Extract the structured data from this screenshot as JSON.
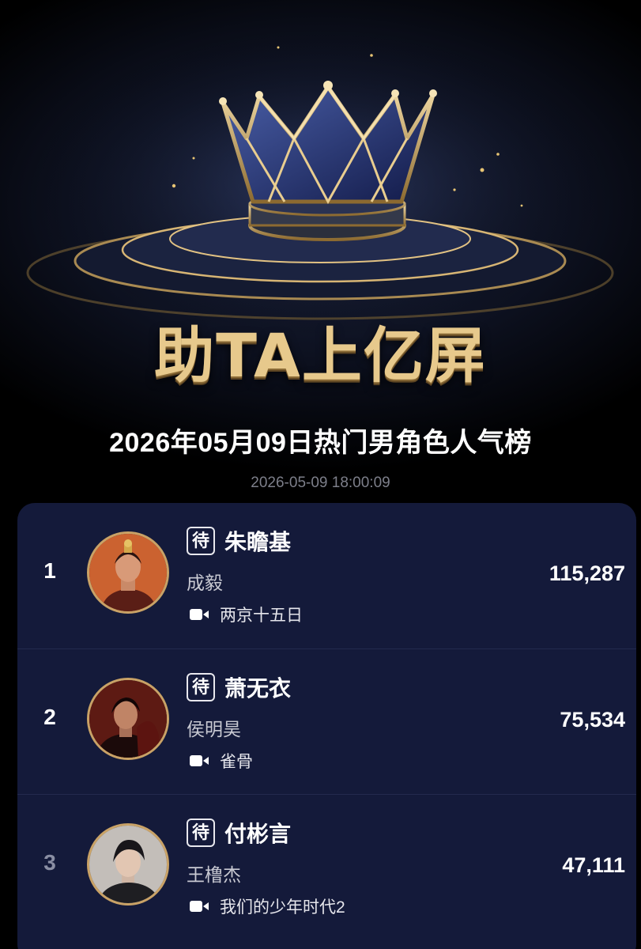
{
  "banner": {
    "title": "助TA上亿屏"
  },
  "list": {
    "title": "2026年05月09日热门男角色人气榜",
    "timestamp": "2026-05-09 18:00:09"
  },
  "tag_label": "待",
  "entries": [
    {
      "rank": "1",
      "role": "朱瞻基",
      "actor": "成毅",
      "drama": "两京十五日",
      "score": "115,287"
    },
    {
      "rank": "2",
      "role": "萧无衣",
      "actor": "侯明昊",
      "drama": "雀骨",
      "score": "75,534"
    },
    {
      "rank": "3",
      "role": "付彬言",
      "actor": "王橹杰",
      "drama": "我们的少年时代2",
      "score": "47,111"
    }
  ],
  "colors": {
    "background": "#000000",
    "card": "#141a3a",
    "gold": "#c9a266",
    "text": "#ffffff",
    "muted": "#7d7f8a"
  },
  "icons": {
    "crown": "crown-icon",
    "drama": "video-camera-icon"
  }
}
